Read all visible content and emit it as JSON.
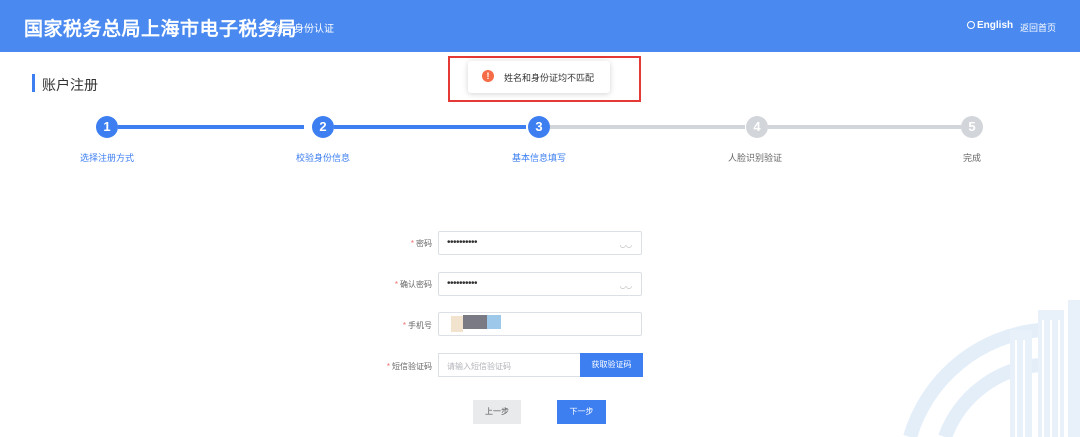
{
  "header": {
    "brand": "国家税务总局上海市电子税务局",
    "subtitle": "统一身份认证",
    "lang_label": "English",
    "home_label": "返回首页"
  },
  "page": {
    "title": "账户注册"
  },
  "toast": {
    "message": "姓名和身份证均不匹配",
    "icon": "warning-icon"
  },
  "steps": [
    {
      "number": "1",
      "label": "选择注册方式",
      "status": "done"
    },
    {
      "number": "2",
      "label": "校验身份信息",
      "status": "done"
    },
    {
      "number": "3",
      "label": "基本信息填写",
      "status": "current"
    },
    {
      "number": "4",
      "label": "人脸识别验证",
      "status": "pending"
    },
    {
      "number": "5",
      "label": "完成",
      "status": "pending"
    }
  ],
  "form": {
    "password": {
      "label": "密码",
      "value": "••••••••••"
    },
    "confirm_password": {
      "label": "确认密码",
      "value": "••••••••••"
    },
    "phone": {
      "label": "手机号"
    },
    "sms_code": {
      "label": "短信验证码",
      "placeholder": "请输入短信验证码",
      "button": "获取验证码"
    },
    "prev_button": "上一步",
    "next_button": "下一步"
  },
  "colors": {
    "header_bg": "#4a8af0",
    "primary": "#3d7ff0",
    "inactive": "#d2d5da",
    "toast_icon": "#f56c47",
    "highlight": "#e53935"
  }
}
